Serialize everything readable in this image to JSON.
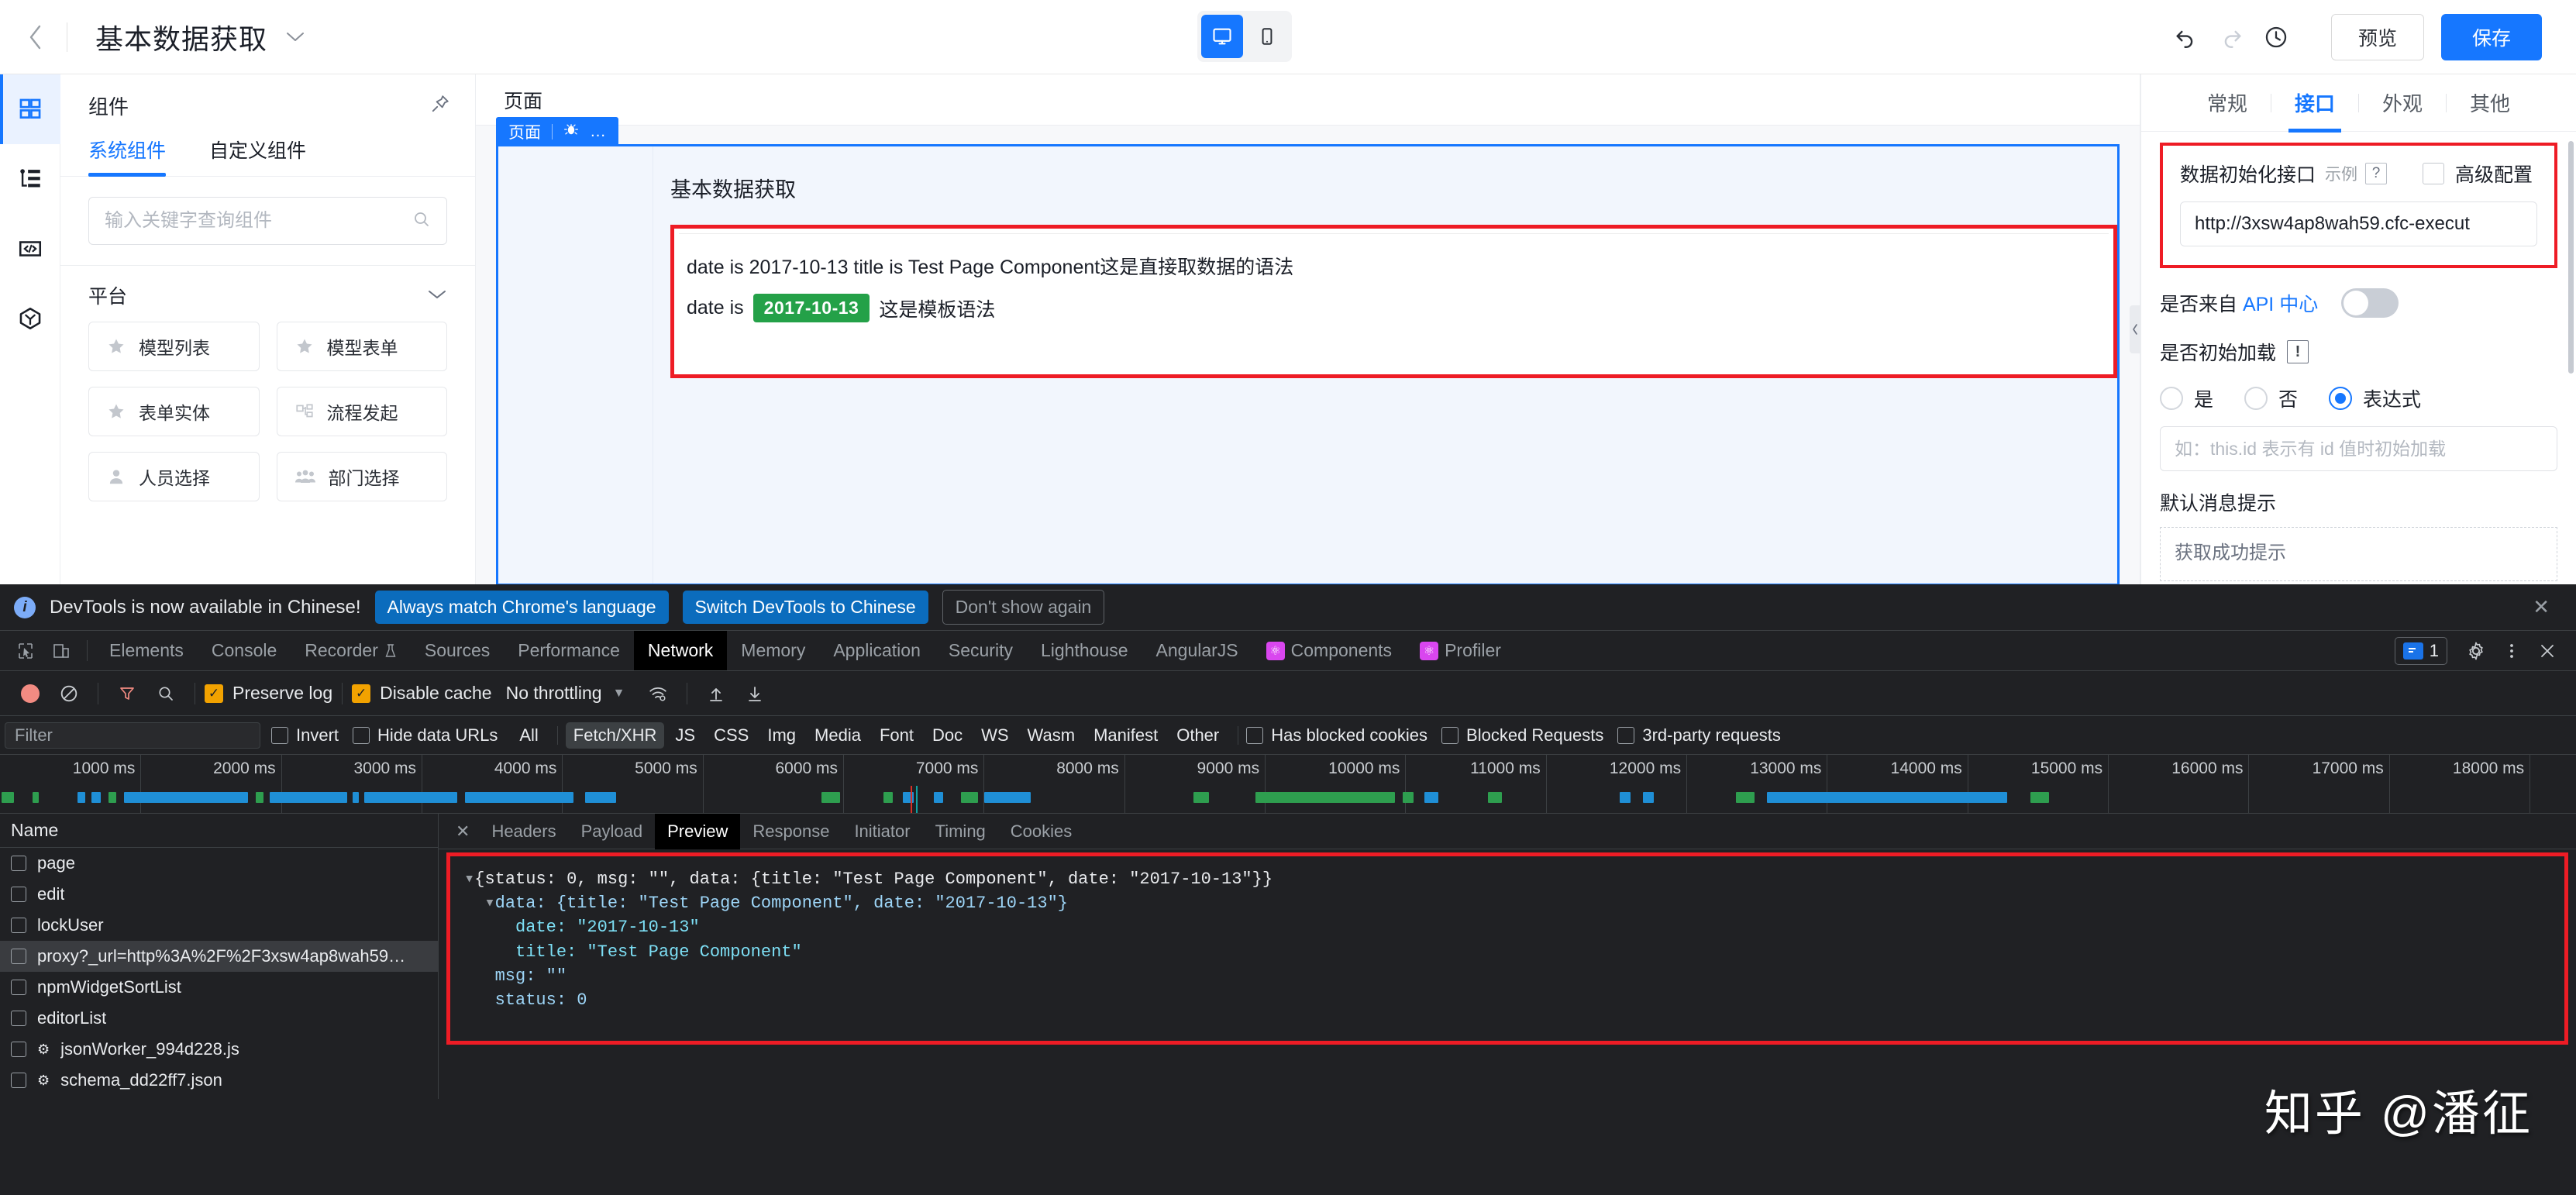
{
  "topbar": {
    "back_icon": "chevron-left-icon",
    "doc_title": "基本数据获取",
    "title_caret": "chevron-down-icon",
    "device_desktop": "desktop-icon",
    "device_mobile": "mobile-icon",
    "undo": "undo-icon",
    "redo": "redo-icon",
    "history": "history-clock-icon",
    "preview_label": "预览",
    "save_label": "保存"
  },
  "rail": [
    {
      "name": "components",
      "icon": "grid-icon",
      "active": true
    },
    {
      "name": "outline",
      "icon": "tree-outline-icon",
      "active": false
    },
    {
      "name": "code",
      "icon": "code-brackets-icon",
      "active": false
    },
    {
      "name": "package",
      "icon": "cube-icon",
      "active": false
    }
  ],
  "components_panel": {
    "title": "组件",
    "pin_icon": "pin-icon",
    "tabs": [
      {
        "label": "系统组件",
        "active": true
      },
      {
        "label": "自定义组件",
        "active": false
      }
    ],
    "search_placeholder": "输入关键字查询组件",
    "search_value": "",
    "search_icon": "search-icon",
    "group_label": "平台",
    "group_caret": "chevron-down-icon",
    "items": [
      {
        "label": "模型列表",
        "icon": "star-icon"
      },
      {
        "label": "模型表单",
        "icon": "star-icon"
      },
      {
        "label": "表单实体",
        "icon": "star-icon"
      },
      {
        "label": "流程发起",
        "icon": "flow-node-icon"
      },
      {
        "label": "人员选择",
        "icon": "person-icon"
      },
      {
        "label": "部门选择",
        "icon": "people-group-icon"
      }
    ]
  },
  "canvas": {
    "header": "页面",
    "page_tag": "页面",
    "page_tag_icon": "bug-icon",
    "page_tag_more": "…",
    "heading": "基本数据获取",
    "line1": "date is 2017-10-13 title is Test Page Component这是直接取数据的语法",
    "line2_prefix": "date is",
    "line2_chip": "2017-10-13",
    "line2_suffix": "这是模板语法",
    "collapse_icon": "chevron-left-icon",
    "highlight_color": "#ee1c25",
    "chip_color": "#24a148",
    "frame_color": "#1677ff"
  },
  "props": {
    "expander_icon": "chevron-right-icon",
    "tabs": [
      {
        "label": "常规",
        "active": false
      },
      {
        "label": "接口",
        "active": true
      },
      {
        "label": "外观",
        "active": false
      },
      {
        "label": "其他",
        "active": false
      }
    ],
    "api_section": {
      "label": "数据初始化接口",
      "example_label": "示例",
      "help_icon": "?",
      "advanced_label": "高级配置",
      "advanced_checked": false,
      "url_value": "http://3xsw4ap8wah59.cfc-execut",
      "highlight_color": "#ee1c25"
    },
    "api_center": {
      "label_prefix": "是否来自 ",
      "label_link": "API 中心",
      "toggle_on": false
    },
    "init_load": {
      "label": "是否初始加载",
      "warn_icon": "!",
      "options": [
        {
          "label": "是",
          "checked": false
        },
        {
          "label": "否",
          "checked": false
        },
        {
          "label": "表达式",
          "checked": true
        }
      ],
      "expr_placeholder": "如：this.id 表示有 id 值时初始加载",
      "expr_value": ""
    },
    "default_message": {
      "label": "默认消息提示",
      "box_text": "获取成功提示"
    }
  },
  "devtools": {
    "banner": {
      "info_icon": "info-icon",
      "text": "DevTools is now available in Chinese!",
      "btn_always": "Always match Chrome's language",
      "btn_switch": "Switch DevTools to Chinese",
      "btn_dismiss": "Don't show again",
      "close_icon": "close-icon"
    },
    "tabs": {
      "inspect_icon": "inspect-cursor-icon",
      "device_icon": "device-toolbar-icon",
      "items": [
        {
          "label": "Elements",
          "active": false
        },
        {
          "label": "Console",
          "active": false
        },
        {
          "label": "Recorder",
          "active": false,
          "badge": "flask-icon"
        },
        {
          "label": "Sources",
          "active": false
        },
        {
          "label": "Performance",
          "active": false
        },
        {
          "label": "Network",
          "active": true
        },
        {
          "label": "Memory",
          "active": false
        },
        {
          "label": "Application",
          "active": false
        },
        {
          "label": "Security",
          "active": false
        },
        {
          "label": "Lighthouse",
          "active": false
        },
        {
          "label": "AngularJS",
          "active": false
        },
        {
          "label": "Components",
          "active": false,
          "react": true
        },
        {
          "label": "Profiler",
          "active": false,
          "react": true
        }
      ],
      "issue_count": "1",
      "settings_icon": "gear-icon",
      "more_icon": "kebab-menu-icon",
      "close_icon": "close-icon"
    },
    "toolbar": {
      "record_icon": "record-icon",
      "clear_icon": "clear-icon",
      "filter_icon": "filter-funnel-icon",
      "search_icon": "search-icon",
      "preserve_log_label": "Preserve log",
      "preserve_log_checked": true,
      "disable_cache_label": "Disable cache",
      "disable_cache_checked": true,
      "throttling_label": "No throttling",
      "throttling_caret": "chevron-down-icon",
      "wifi_icon": "network-conditions-icon",
      "import_icon": "upload-arrow-icon",
      "export_icon": "download-arrow-icon"
    },
    "filterbar": {
      "filter_placeholder": "Filter",
      "filter_value": "",
      "invert_label": "Invert",
      "invert_checked": false,
      "hide_data_urls_label": "Hide data URLs",
      "hide_data_urls_checked": false,
      "types": [
        {
          "label": "All",
          "active": false
        },
        {
          "label": "Fetch/XHR",
          "active": true
        },
        {
          "label": "JS",
          "active": false
        },
        {
          "label": "CSS",
          "active": false
        },
        {
          "label": "Img",
          "active": false
        },
        {
          "label": "Media",
          "active": false
        },
        {
          "label": "Font",
          "active": false
        },
        {
          "label": "Doc",
          "active": false
        },
        {
          "label": "WS",
          "active": false
        },
        {
          "label": "Wasm",
          "active": false
        },
        {
          "label": "Manifest",
          "active": false
        },
        {
          "label": "Other",
          "active": false
        }
      ],
      "has_blocked_cookies": "Has blocked cookies",
      "blocked_requests": "Blocked Requests",
      "third_party_requests": "3rd-party requests"
    },
    "timeline": {
      "ticks": [
        "1000 ms",
        "2000 ms",
        "3000 ms",
        "4000 ms",
        "5000 ms",
        "6000 ms",
        "7000 ms",
        "8000 ms",
        "9000 ms",
        "10000 ms",
        "11000 ms",
        "12000 ms",
        "13000 ms",
        "14000 ms",
        "15000 ms",
        "16000 ms",
        "17000 ms",
        "18000 ms"
      ]
    },
    "requests": {
      "name_header": "Name",
      "rows": [
        {
          "name": "page",
          "selected": false,
          "gear": false
        },
        {
          "name": "edit",
          "selected": false,
          "gear": false
        },
        {
          "name": "lockUser",
          "selected": false,
          "gear": false
        },
        {
          "name": "proxy?_url=http%3A%2F%2F3xsw4ap8wah59…",
          "selected": true,
          "gear": false
        },
        {
          "name": "npmWidgetSortList",
          "selected": false,
          "gear": false
        },
        {
          "name": "editorList",
          "selected": false,
          "gear": false
        },
        {
          "name": "jsonWorker_994d228.js",
          "selected": false,
          "gear": true
        },
        {
          "name": "schema_dd22ff7.json",
          "selected": false,
          "gear": true
        }
      ]
    },
    "detail": {
      "close_icon": "close-icon",
      "tabs": [
        {
          "label": "Headers",
          "active": false
        },
        {
          "label": "Payload",
          "active": false
        },
        {
          "label": "Preview",
          "active": true
        },
        {
          "label": "Response",
          "active": false
        },
        {
          "label": "Initiator",
          "active": false
        },
        {
          "label": "Timing",
          "active": false
        },
        {
          "label": "Cookies",
          "active": false
        }
      ],
      "highlight_color": "#ee1c25",
      "preview_lines": [
        "{status: 0, msg: \"\", data: {title: \"Test Page Component\", date: \"2017-10-13\"}}",
        "data: {title: \"Test Page Component\", date: \"2017-10-13\"}",
        "date: \"2017-10-13\"",
        "title: \"Test Page Component\"",
        "msg: \"\"",
        "status: 0"
      ]
    },
    "watermark": "知乎 @潘征"
  }
}
